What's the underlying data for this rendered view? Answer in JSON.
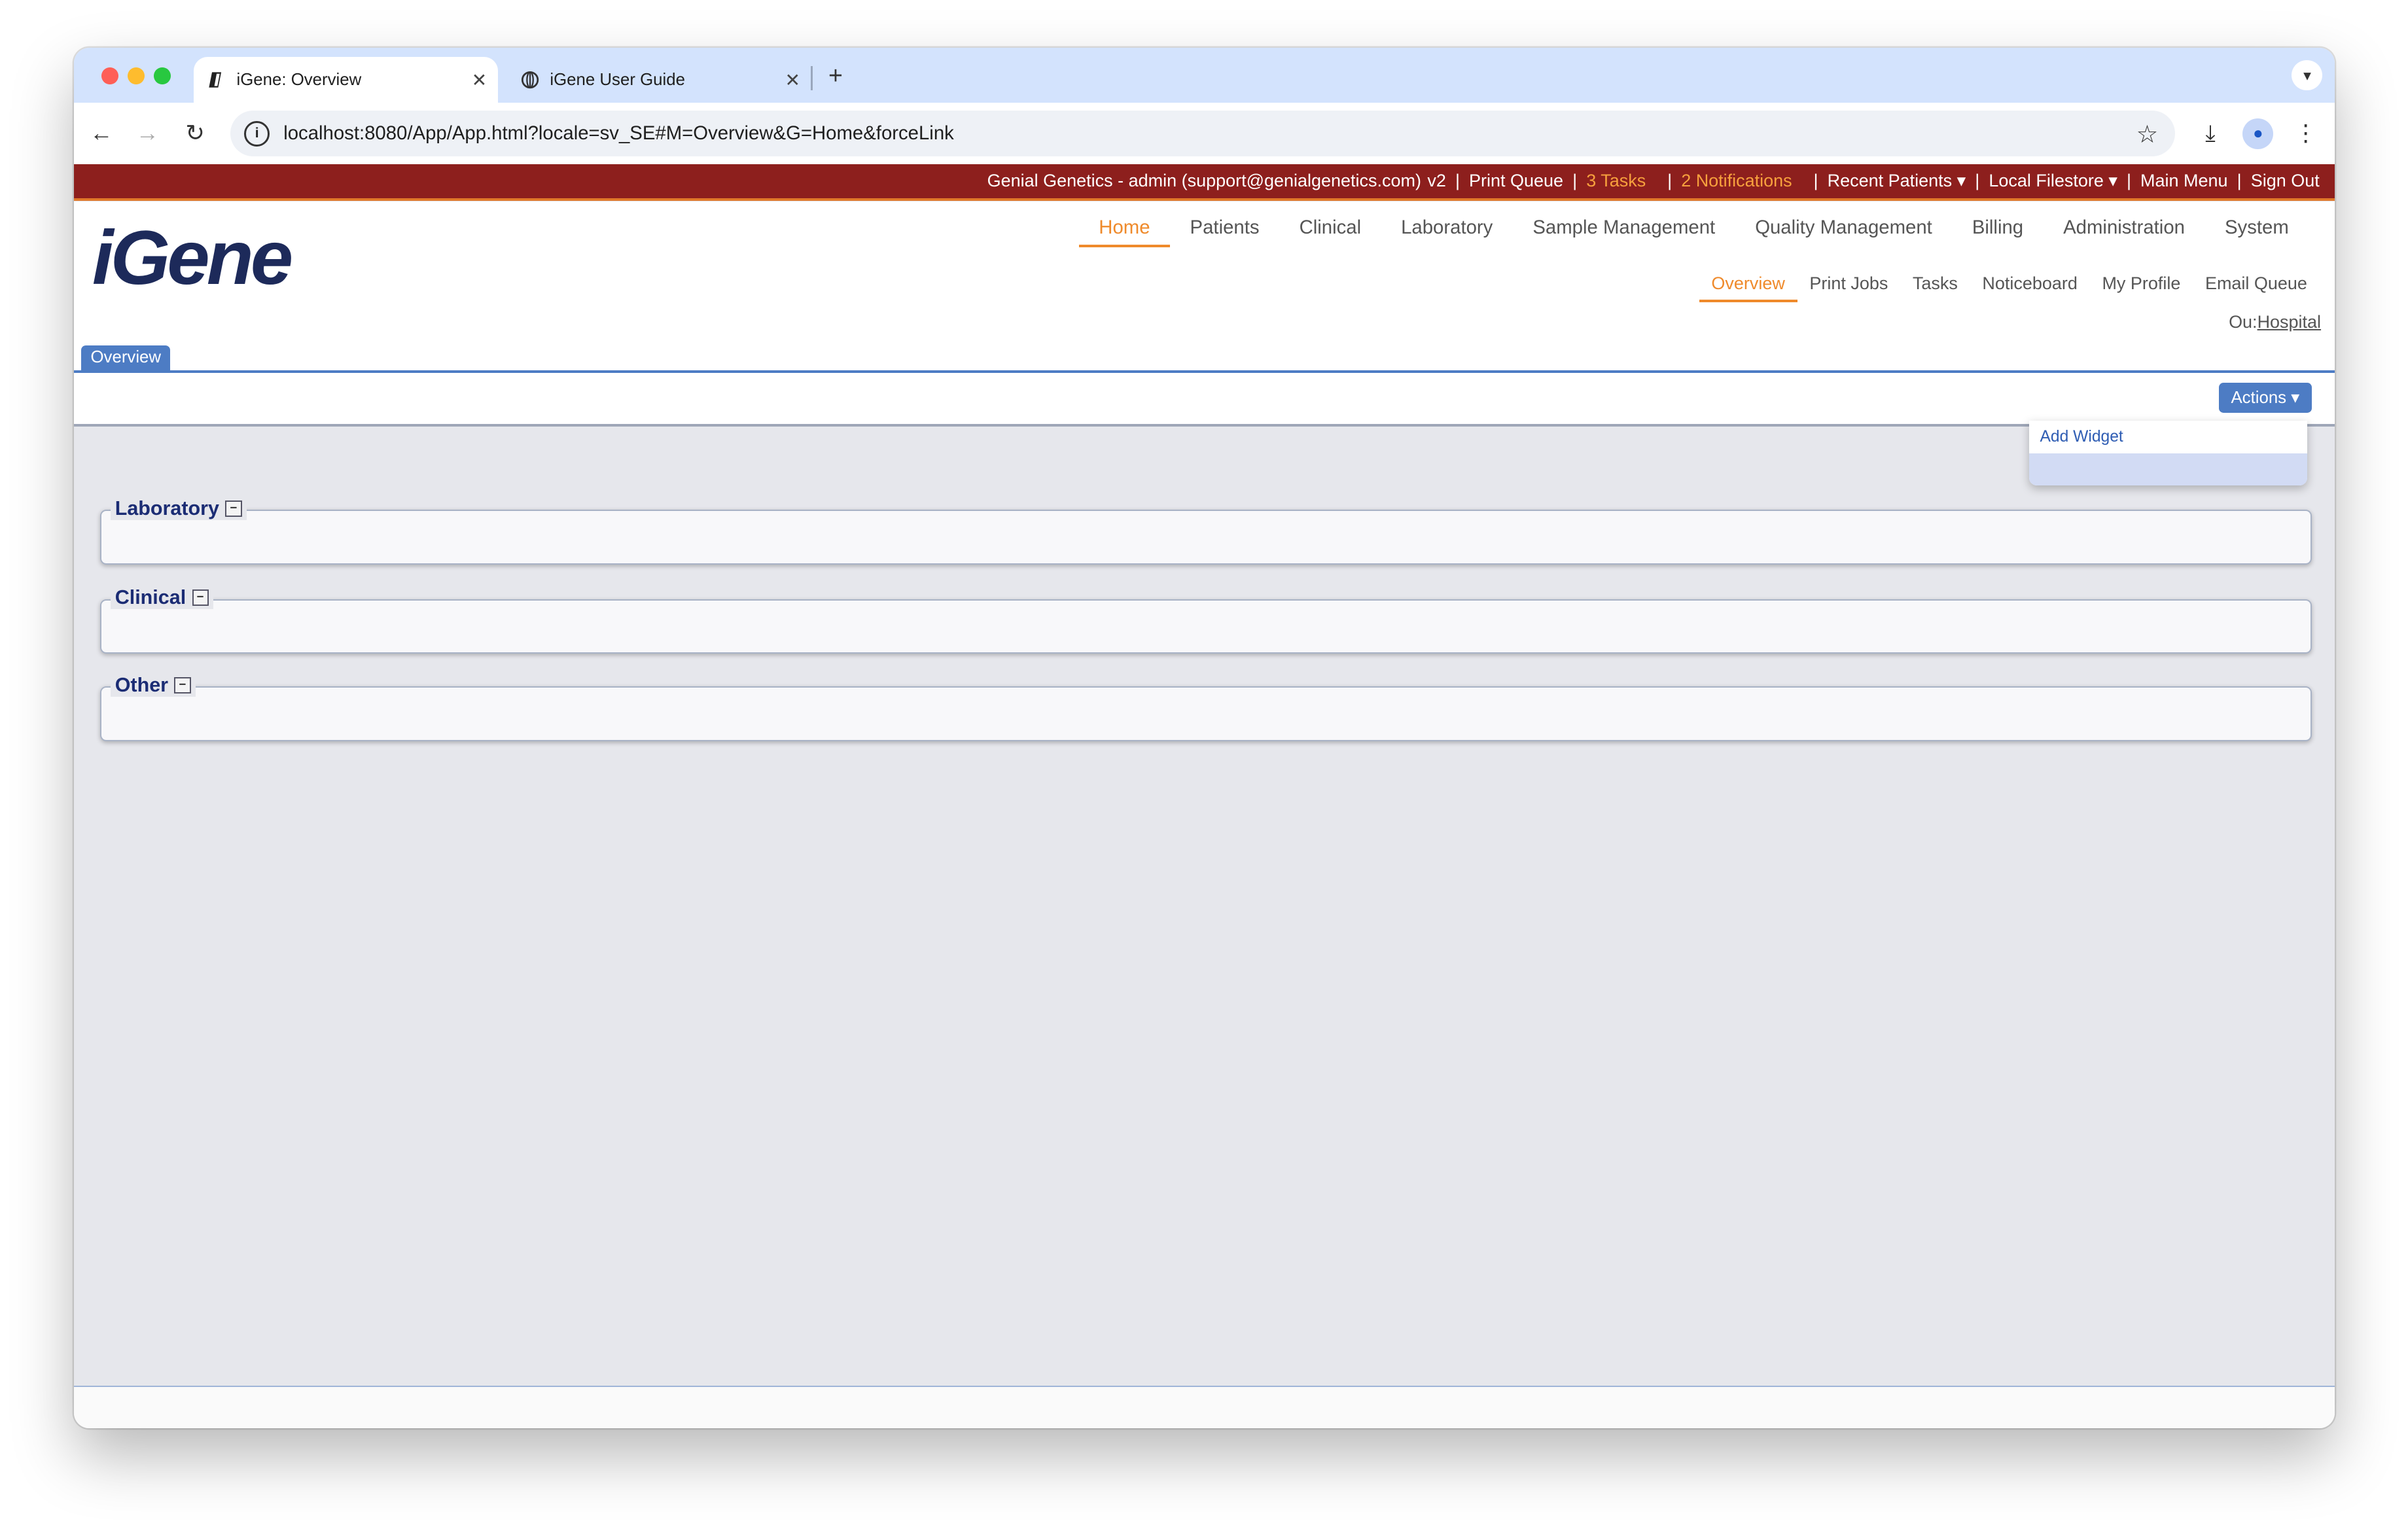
{
  "browser": {
    "tabs": [
      {
        "title": "iGene: Overview",
        "close": "✕"
      },
      {
        "title": "iGene User Guide",
        "close": "✕"
      }
    ],
    "new_tab": "+",
    "url": "localhost:8080/App/App.html?locale=sv_SE#M=Overview&G=Home&forceLink"
  },
  "topbar": {
    "account": "Genial Genetics - admin (support@genialgenetics.com)",
    "version": "v2",
    "print_queue": "Print Queue",
    "tasks": "3 Tasks",
    "notifications": "2 Notifications",
    "recent_patients": "Recent Patients ▾",
    "local_filestore": "Local Filestore ▾",
    "main_menu": "Main Menu",
    "sign_out": "Sign Out",
    "separator": "|",
    "warn_color": "#f7a13d",
    "bar_color": "#8d1f1d"
  },
  "header": {
    "logo": "iGene",
    "main_nav": [
      "Home",
      "Patients",
      "Clinical",
      "Laboratory",
      "Sample Management",
      "Quality Management",
      "Billing",
      "Administration",
      "System"
    ],
    "active_main": "Home",
    "sub_nav": [
      "Overview",
      "Print Jobs",
      "Tasks",
      "Noticeboard",
      "My Profile",
      "Email Queue"
    ],
    "active_sub": "Overview",
    "ou_label": "Ou:",
    "ou_value": "Hospital"
  },
  "page": {
    "tab": "Overview",
    "actions_button": "Actions ▾",
    "actions_menu": [
      "Add Widget"
    ],
    "sections": [
      "Laboratory",
      "Clinical",
      "Other"
    ],
    "collapse_glyph": "−",
    "accent_color": "#4d7cc4",
    "active_color": "#ef8a2b"
  }
}
